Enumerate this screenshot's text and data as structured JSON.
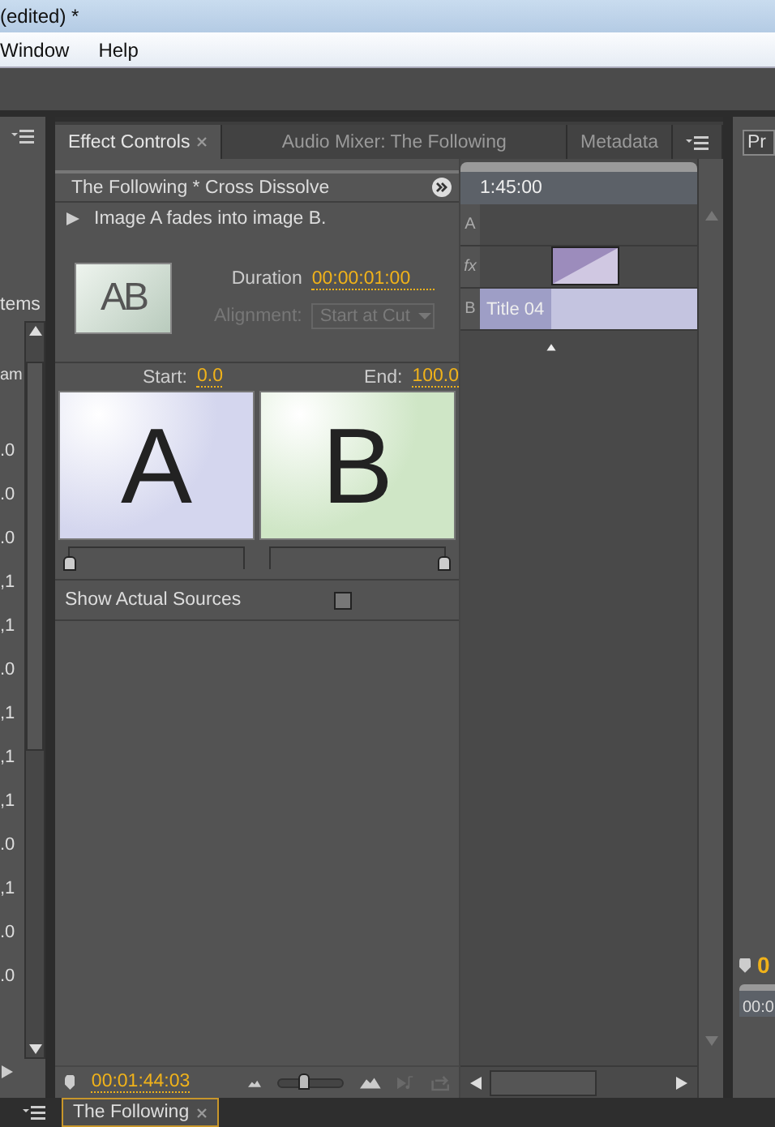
{
  "title_bar": {
    "title": "(edited) *"
  },
  "menu": [
    "Window",
    "Help"
  ],
  "left_panel": {
    "label": "tems",
    "column_header": "am",
    "values": [
      ".0",
      ".0",
      ".0",
      ",1",
      ",1",
      ".0",
      ",1",
      ",1",
      ",1",
      ".0",
      ",1",
      ".0",
      ".0"
    ]
  },
  "effect_controls": {
    "tabs": [
      {
        "label": "Effect Controls",
        "selected": true
      },
      {
        "label": "Audio Mixer: The Following",
        "selected": false
      },
      {
        "label": "Metadata",
        "selected": false
      }
    ],
    "clip_title": "The Following * Cross Dissolve",
    "description": "Image A fades into image B.",
    "thumbnail_text": "AB",
    "duration_label": "Duration",
    "duration": "00:00:01:00",
    "alignment_label": "Alignment:",
    "alignment": {
      "value": "Start at Cut",
      "disabled": true
    },
    "start_label": "Start:",
    "start": "0.0",
    "end_label": "End:",
    "end": "100.0",
    "previews": [
      {
        "letter": "A",
        "color": "#d4d6ee",
        "level": 0
      },
      {
        "letter": "B",
        "color": "#cfe6c6",
        "level": 1
      }
    ],
    "show_actual_sources": {
      "label": "Show Actual Sources",
      "checked": false
    },
    "timecode": "00:01:44:03",
    "zoom": {
      "level": 0.38
    },
    "timeline": {
      "ruler": "1:45:00",
      "track_labels": [
        "A",
        "fx",
        "B"
      ],
      "clip": "Title 04"
    }
  },
  "right_panel": {
    "tab": "Pr",
    "timecode": "0",
    "ruler": "00:0"
  },
  "bottom_tab": {
    "label": "The Following",
    "selected": true
  }
}
